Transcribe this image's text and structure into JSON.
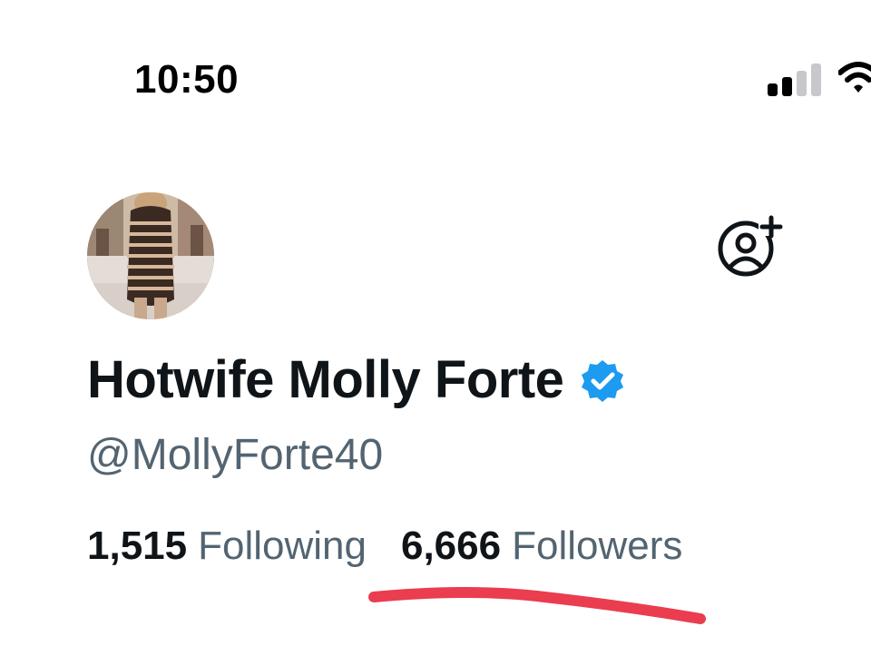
{
  "status_bar": {
    "time": "10:50",
    "signal_icon": "cellular-signal-icon",
    "wifi_icon": "wifi-icon"
  },
  "profile": {
    "display_name": "Hotwife Molly Forte",
    "handle": "@MollyForte40",
    "verified": true,
    "verified_color": "#1d9bf0",
    "follow_icon": "add-user-icon",
    "following_count": "1,515",
    "following_label": "Following",
    "followers_count": "6,666",
    "followers_label": "Followers"
  },
  "annotation": {
    "underline_color": "#e8283c"
  }
}
